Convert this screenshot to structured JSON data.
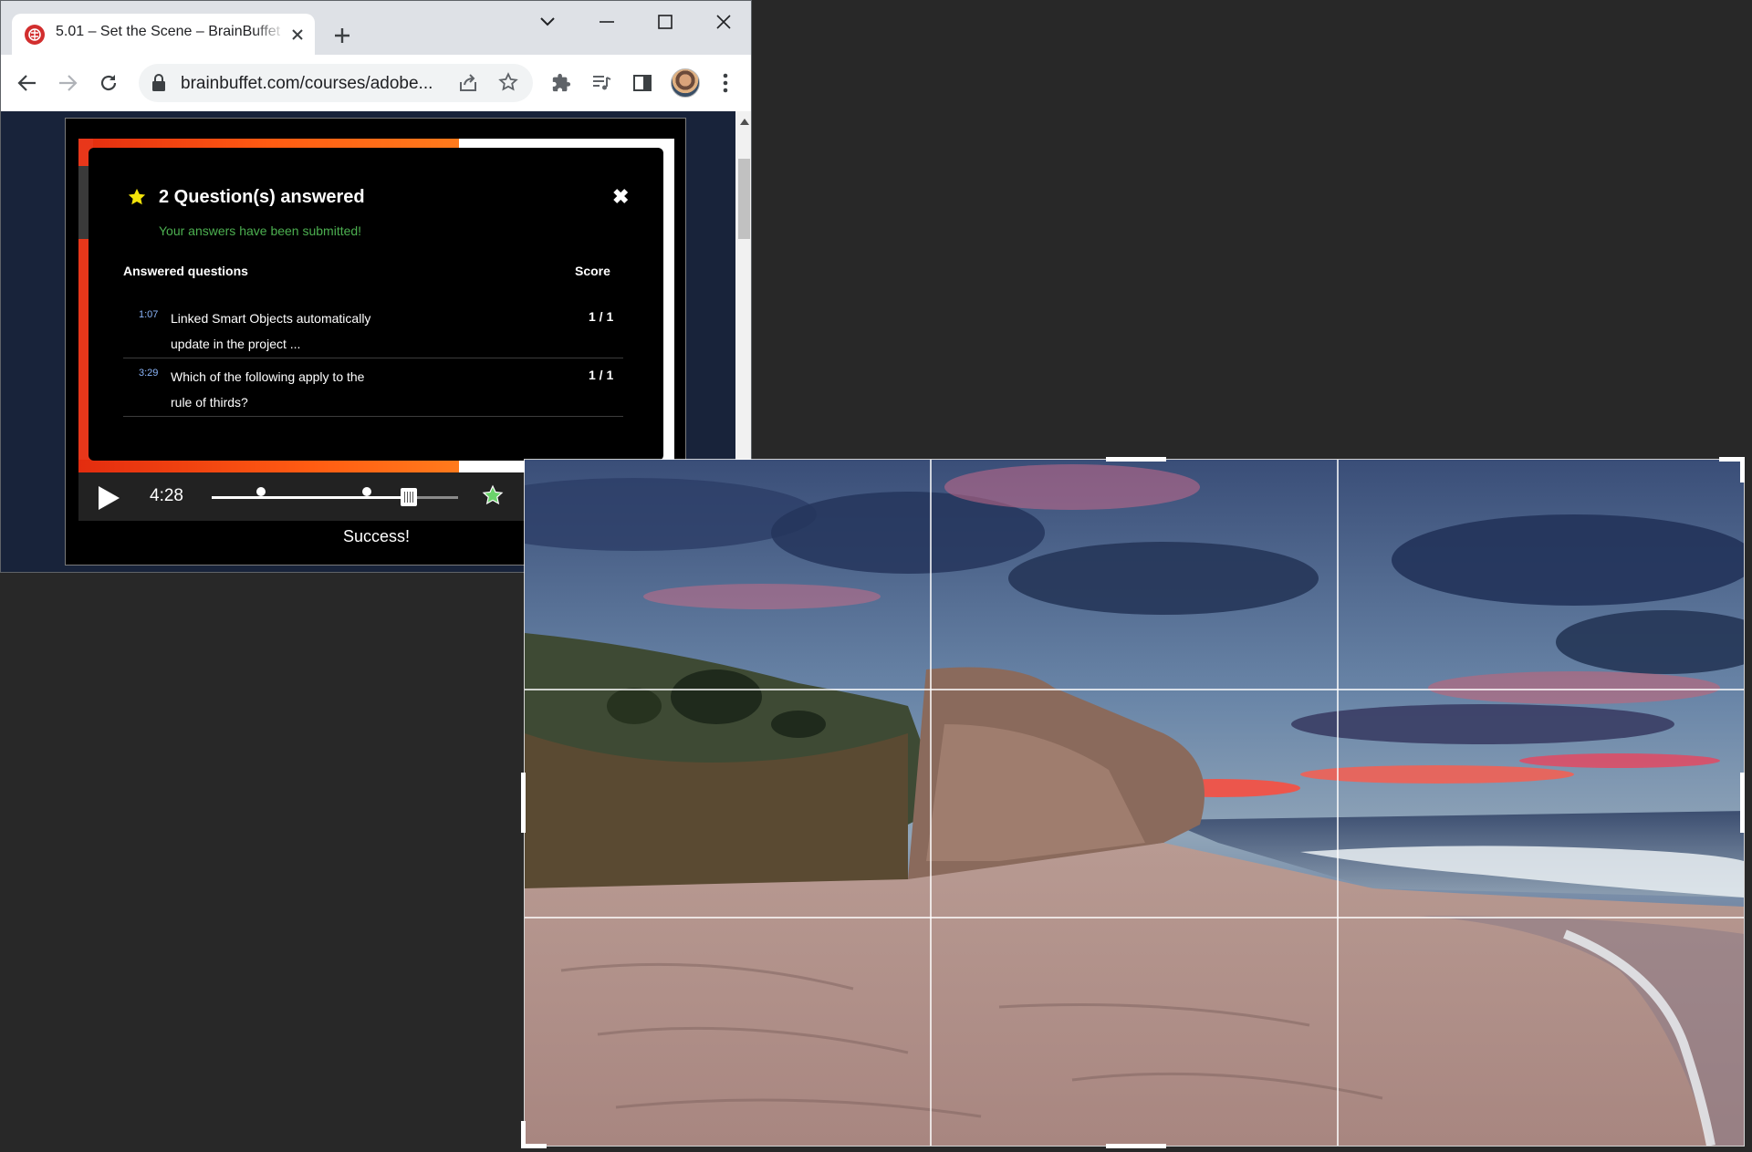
{
  "browser": {
    "tab_title": "5.01 – Set the Scene – BrainBuffet",
    "url": "brainbuffet.com/courses/adobe...",
    "accent_color": "#d22e2e"
  },
  "quiz": {
    "title": "2 Question(s) answered",
    "subtitle": "Your answers have been submitted!",
    "col_questions": "Answered questions",
    "col_score": "Score",
    "close_glyph": "✖",
    "questions": [
      {
        "time": "1:07",
        "text": "Linked Smart Objects automatically update in the project ...",
        "score": "1 / 1"
      },
      {
        "time": "3:29",
        "text": "Which of the following apply to the rule of thirds?",
        "score": "1 / 1"
      }
    ]
  },
  "player": {
    "time": "4:28",
    "progress": 0.8,
    "markers": [
      0.2,
      0.63
    ],
    "status": "Success!",
    "subtitle_color": "#4caf50"
  }
}
